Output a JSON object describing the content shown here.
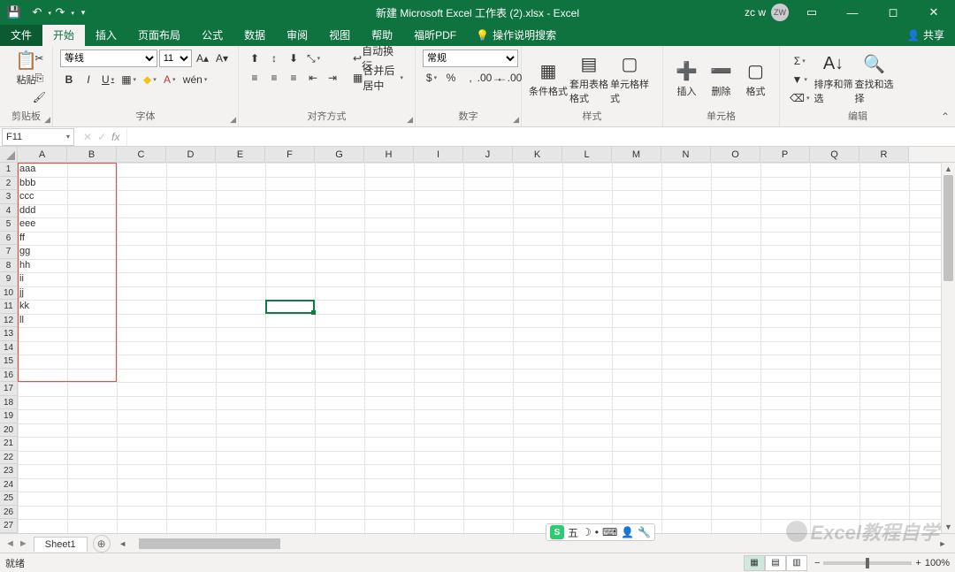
{
  "title": "新建 Microsoft Excel 工作表 (2).xlsx  -  Excel",
  "user": {
    "name": "zc w",
    "initials": "ZW"
  },
  "tabs": {
    "file": "文件",
    "home": "开始",
    "insert": "插入",
    "layout": "页面布局",
    "formula": "公式",
    "data": "数据",
    "review": "审阅",
    "view": "视图",
    "help": "帮助",
    "foxit": "福昕PDF",
    "tell": "操作说明搜索",
    "share": "共享"
  },
  "ribbon": {
    "clipboard": {
      "label": "剪贴板",
      "paste": "粘贴"
    },
    "font": {
      "label": "字体",
      "name": "等线",
      "size": "11",
      "bold": "B",
      "italic": "I",
      "underline": "U"
    },
    "align": {
      "label": "对齐方式",
      "wrap": "自动换行",
      "merge": "合并后居中"
    },
    "number": {
      "label": "数字",
      "format": "常规"
    },
    "styles": {
      "label": "样式",
      "cond": "条件格式",
      "table": "套用表格格式",
      "cell": "单元格样式"
    },
    "cells": {
      "label": "单元格",
      "insert": "插入",
      "delete": "删除",
      "format": "格式"
    },
    "editing": {
      "label": "编辑",
      "sort": "排序和筛选",
      "find": "查找和选择"
    }
  },
  "namebox": "F11",
  "columns": [
    "A",
    "B",
    "C",
    "D",
    "E",
    "F",
    "G",
    "H",
    "I",
    "J",
    "K",
    "L",
    "M",
    "N",
    "O",
    "P",
    "Q",
    "R"
  ],
  "rowcount": 27,
  "cellsA": [
    "aaa",
    "bbb",
    "ccc",
    "ddd",
    "eee",
    "ff",
    "gg",
    "hh",
    "ii",
    "jj",
    "kk",
    "ll"
  ],
  "sheet": {
    "name": "Sheet1"
  },
  "status": {
    "ready": "就绪",
    "zoom": "100%"
  },
  "ime": {
    "label": "五",
    "dot": "•"
  },
  "watermark": "Excel教程自学"
}
